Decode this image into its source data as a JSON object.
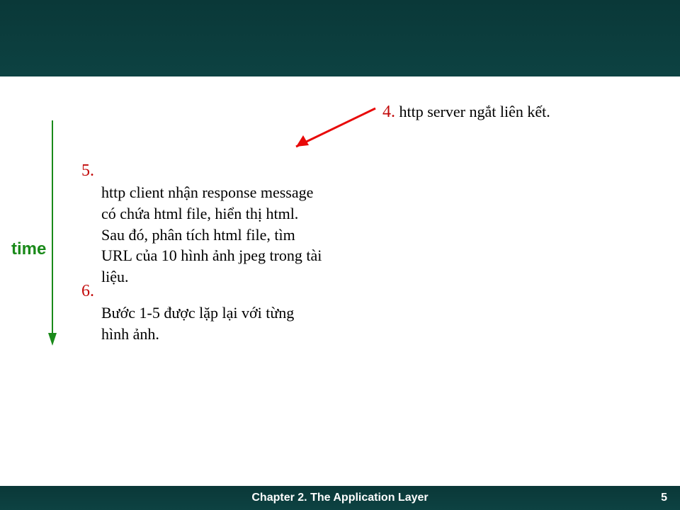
{
  "timeline_label": "time",
  "step4": {
    "num": "4.",
    "text": "http server ngắt liên kết."
  },
  "step5": {
    "num": "5.",
    "text": "http client nhận response message có chứa html file, hiển thị html.  Sau đó, phân tích html file, tìm URL của 10 hình ảnh jpeg trong tài liệu."
  },
  "step6": {
    "num": "6.",
    "text": "Bước 1-5 được lặp lại với từng hình ảnh."
  },
  "footer": {
    "title": "Chapter 2. The Application Layer",
    "page": "5"
  }
}
